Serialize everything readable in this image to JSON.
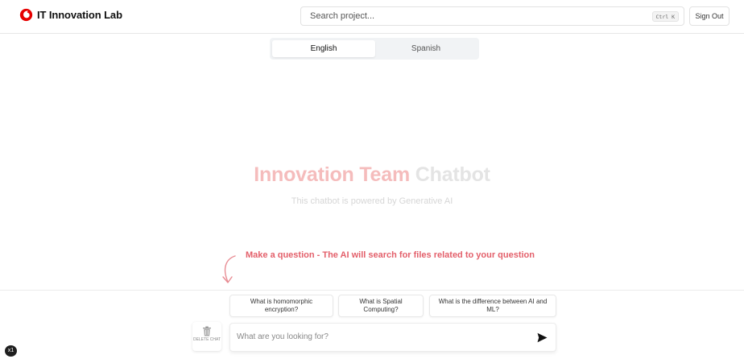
{
  "header": {
    "brand_name": "IT Innovation Lab",
    "search_placeholder": "Search project...",
    "search_shortcut": "Ctrl K",
    "signout_label": "Sign Out"
  },
  "language_tabs": [
    {
      "label": "English",
      "active": true
    },
    {
      "label": "Spanish",
      "active": false
    }
  ],
  "hero": {
    "title_part1": "Innovation Team",
    "title_part2": "Chatbot",
    "subtitle": "This chatbot is powered by Generative AI"
  },
  "hint": "Make a question - The AI will search for files related to your question",
  "suggestions": [
    "What is homomorphic encryption?",
    "What is Spatial Computing?",
    "What is the difference between AI and ML?"
  ],
  "chat": {
    "delete_label": "DELETE CHAT",
    "input_placeholder": "What are you looking for?"
  },
  "corner_badge": "x1",
  "colors": {
    "brand_red": "#e60000",
    "hint_red": "#e35f6a",
    "title_pink": "#f5bcbc"
  },
  "icons": {
    "brand": "vodafone-logo-icon",
    "hint": "curved-arrow-down-icon",
    "delete": "trash-icon",
    "send": "send-icon"
  }
}
